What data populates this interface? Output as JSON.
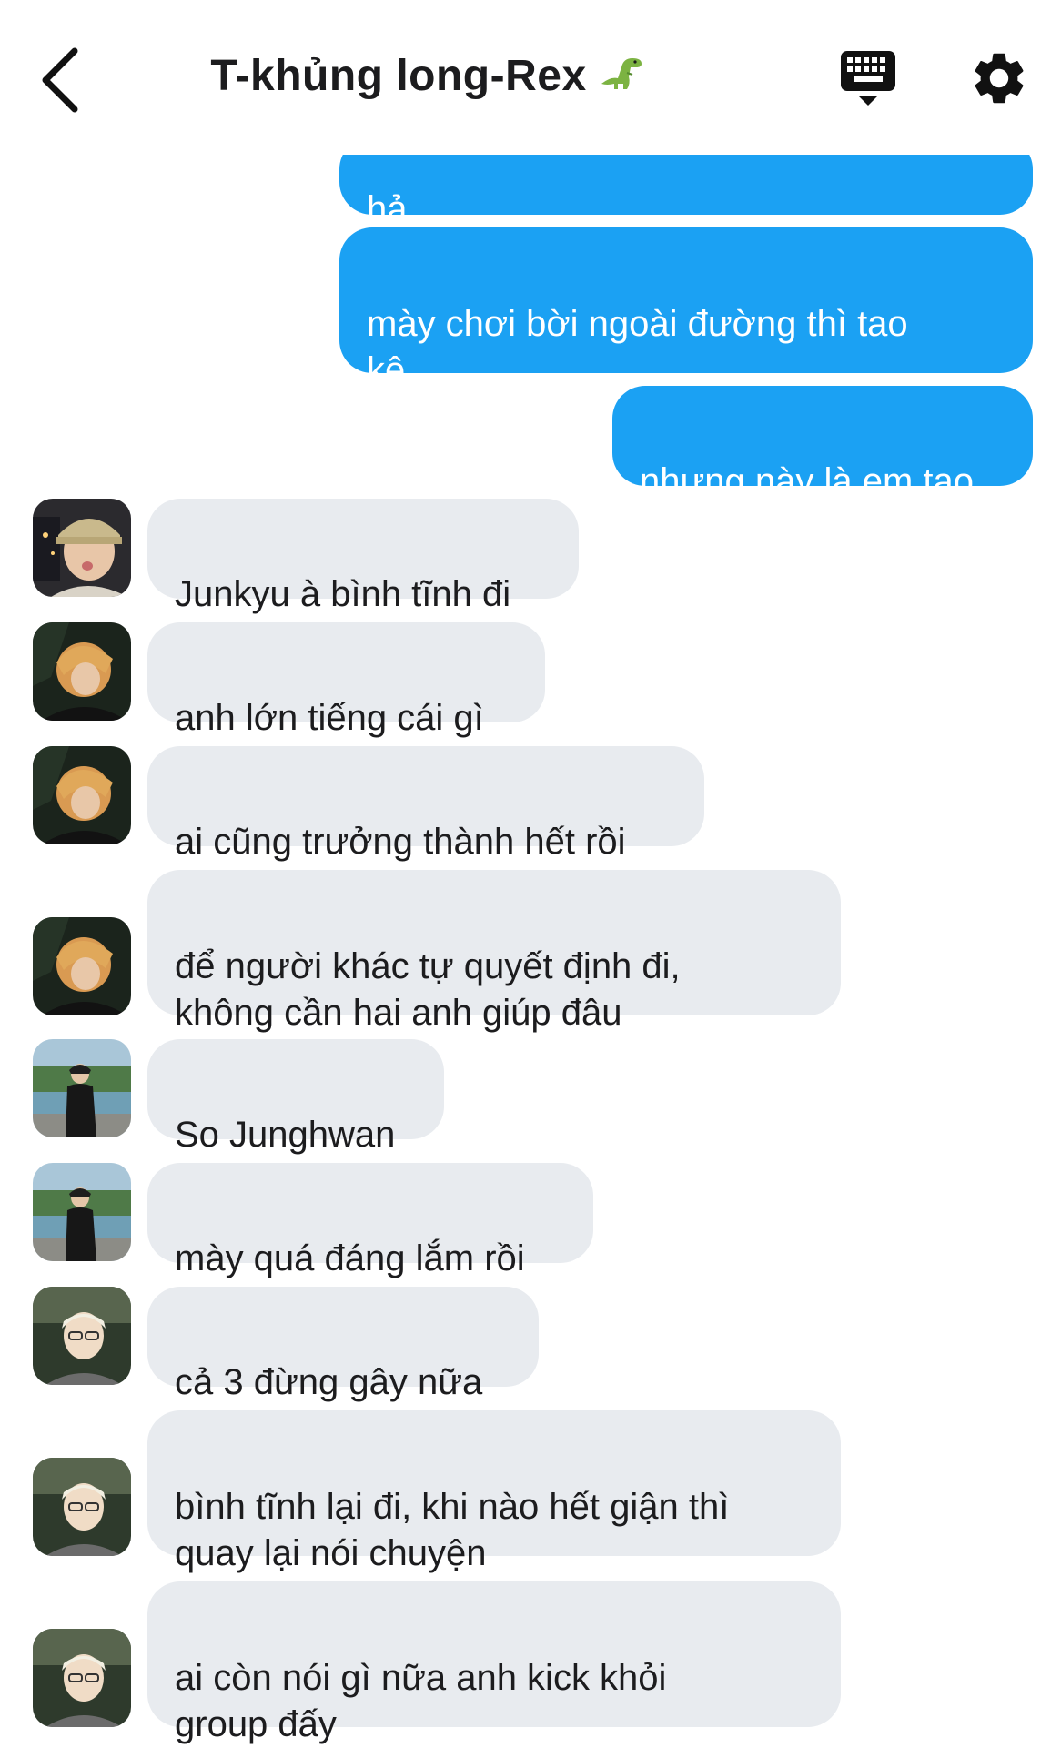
{
  "header": {
    "title": "T-khủng long-Rex",
    "title_emoji": "🦖"
  },
  "icons": {
    "back": "chevron-left-icon",
    "keyboard": "keyboard-icon",
    "settings": "gear-icon"
  },
  "colors": {
    "outgoing_bubble": "#1ba1f3",
    "incoming_bubble": "#e8ebef",
    "text_dark": "#1c1c1e"
  },
  "messages": {
    "out": [
      {
        "text": "hả"
      },
      {
        "text": "mày chơi bời ngoài đường thì tao\nkệ"
      },
      {
        "text": "nhưng này là em tao"
      }
    ],
    "in": [
      {
        "text": "Junkyu à bình tĩnh đi"
      },
      {
        "text": "anh lớn tiếng cái gì"
      },
      {
        "text": "ai cũng trưởng thành hết rồi"
      },
      {
        "text": "để người khác tự quyết định đi,\nkhông cần hai anh giúp đâu"
      },
      {
        "text": "So Junghwan"
      },
      {
        "text": "mày quá đáng lắm rồi"
      },
      {
        "text": "cả 3 đừng gây nữa"
      },
      {
        "text": "bình tĩnh lại đi, khi nào hết giận thì\nquay lại nói chuyện"
      },
      {
        "text": "ai còn nói gì nữa anh kick khỏi\ngroup đấy"
      }
    ]
  }
}
